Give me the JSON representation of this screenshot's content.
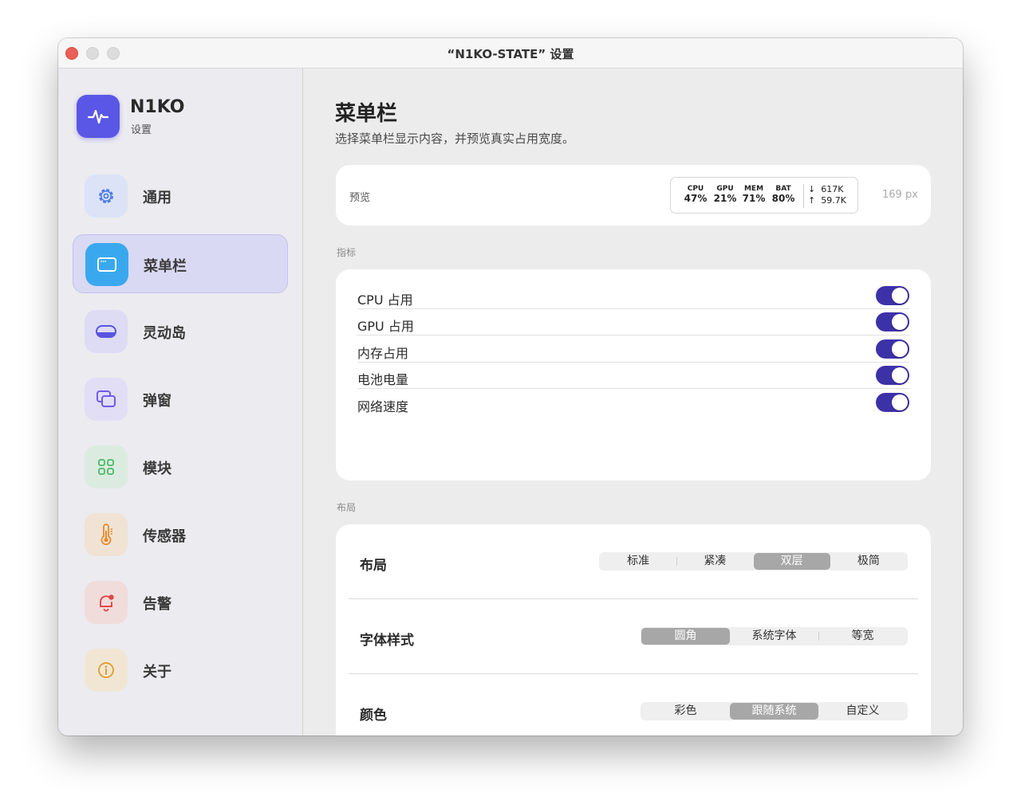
{
  "window": {
    "title": "“N1KO-STATE” 设置"
  },
  "sidebar": {
    "app_name": "N1KO",
    "app_subtitle": "设置",
    "items": [
      {
        "label": "通用",
        "icon": "gear-icon",
        "color": "#4a7ce8"
      },
      {
        "label": "菜单栏",
        "icon": "menubar-window-icon",
        "color": "#3aa8ef",
        "active": true
      },
      {
        "label": "灵动岛",
        "icon": "dynamic-island-icon",
        "color": "#5a55e0"
      },
      {
        "label": "弹窗",
        "icon": "popup-windows-icon",
        "color": "#6f5ae8"
      },
      {
        "label": "模块",
        "icon": "grid-modules-icon",
        "color": "#49b96a"
      },
      {
        "label": "传感器",
        "icon": "thermometer-icon",
        "color": "#e58a2e"
      },
      {
        "label": "告警",
        "icon": "bell-alert-icon",
        "color": "#e04646"
      },
      {
        "label": "关于",
        "icon": "info-icon",
        "color": "#e0a030"
      }
    ]
  },
  "main": {
    "title": "菜单栏",
    "subtitle": "选择菜单栏显示内容，并预览真实占用宽度。",
    "preview": {
      "label": "预览",
      "stats": [
        {
          "name": "CPU",
          "value": "47%"
        },
        {
          "name": "GPU",
          "value": "21%"
        },
        {
          "name": "MEM",
          "value": "71%"
        },
        {
          "name": "BAT",
          "value": "80%"
        }
      ],
      "net_down": "617K",
      "net_up": "59.7K",
      "width_text": "169 px"
    },
    "metrics_section_label": "指标",
    "metrics": [
      {
        "label": "CPU 占用",
        "on": true
      },
      {
        "label": "GPU 占用",
        "on": true
      },
      {
        "label": "内存占用",
        "on": true
      },
      {
        "label": "电池电量",
        "on": true
      },
      {
        "label": "网络速度",
        "on": true
      }
    ],
    "layout_section_label": "布局",
    "layout_rows": [
      {
        "label": "布局",
        "options": [
          "标准",
          "紧凑",
          "双层",
          "极简"
        ],
        "selected": "双层"
      },
      {
        "label": "字体样式",
        "options": [
          "圆角",
          "系统字体",
          "等宽"
        ],
        "selected": "圆角"
      },
      {
        "label": "颜色",
        "options": [
          "彩色",
          "跟随系统",
          "自定义"
        ],
        "selected": "跟随系统"
      }
    ]
  },
  "colors": {
    "accent": "#3d31a8",
    "app_icon": "#5a57e6",
    "active_nav_bg": "#d9d9f3"
  }
}
